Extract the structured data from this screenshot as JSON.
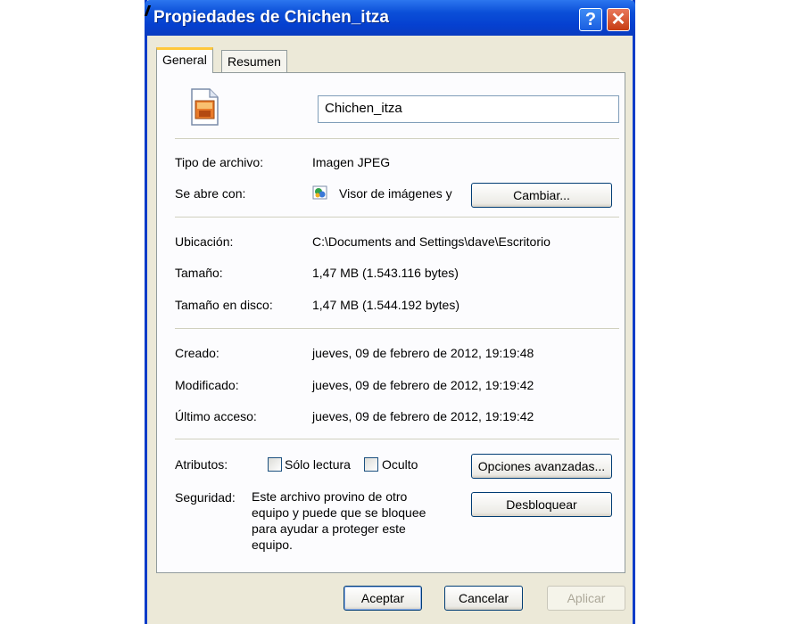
{
  "window": {
    "title": "Propiedades de Chichen_itza",
    "help_label": "?",
    "close_label": "✕"
  },
  "tabs": [
    {
      "label": "General",
      "active": true
    },
    {
      "label": "Resumen",
      "active": false
    }
  ],
  "file": {
    "icon": "jpeg-file-icon",
    "name": "Chichen_itza"
  },
  "type_section": {
    "type_label": "Tipo de archivo:",
    "type_value": "Imagen JPEG",
    "opens_with_label": "Se abre con:",
    "opens_with_icon": "image-viewer-icon",
    "opens_with_value": "Visor de imágenes y",
    "change_button": "Cambiar..."
  },
  "location_section": {
    "location_label": "Ubicación:",
    "location_value": "C:\\Documents and Settings\\dave\\Escritorio",
    "size_label": "Tamaño:",
    "size_value": "1,47 MB (1.543.116 bytes)",
    "disk_size_label": "Tamaño en disco:",
    "disk_size_value": "1,47 MB (1.544.192 bytes)"
  },
  "dates_section": {
    "created_label": "Creado:",
    "created_value": "jueves, 09 de febrero de 2012, 19:19:48",
    "modified_label": "Modificado:",
    "modified_value": "jueves, 09 de febrero de 2012, 19:19:42",
    "accessed_label": "Último acceso:",
    "accessed_value": "jueves, 09 de febrero de 2012, 19:19:42"
  },
  "attributes": {
    "label": "Atributos:",
    "read_only_label": "Sólo lectura",
    "read_only_checked": false,
    "hidden_label": "Oculto",
    "hidden_checked": false,
    "advanced_button": "Opciones avanzadas..."
  },
  "security": {
    "label": "Seguridad:",
    "text": "Este archivo provino de otro equipo y puede que se bloquee para ayudar a proteger este equipo.",
    "unblock_button": "Desbloquear"
  },
  "footer": {
    "ok_button": "Aceptar",
    "cancel_button": "Cancelar",
    "apply_button": "Aplicar"
  },
  "colors": {
    "titlebar": "#0540d0",
    "window_face": "#ece9d8",
    "active_tab_accent": "#ffc83c",
    "close_button": "#c63b12"
  }
}
